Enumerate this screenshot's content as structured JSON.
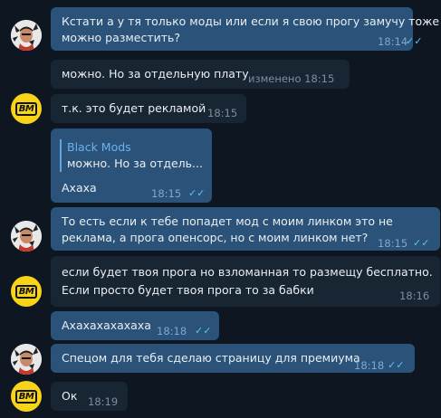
{
  "messages": [
    {
      "text_line1": "Кстати а у тя только моды или если я свою прогу замучу тоже",
      "text_line2": "можно разместить?",
      "time": "18:14"
    },
    {
      "text": "можно. Но за отдельную плату",
      "time": "изменено 18:15"
    },
    {
      "text": "т.к. это будет рекламой",
      "time": "18:15"
    },
    {
      "quote_name": "Black Mods",
      "quote_text": "можно. Но за отдель...",
      "text": "Ахаха",
      "time": "18:15"
    },
    {
      "text_line1": "То есть если к тебе попадет мод с моим линком это не",
      "text_line2": "реклама, а прога опенсорс, но с моим линком нет?",
      "time": "18:15"
    },
    {
      "text_line1": "если будет твоя прога но взломанная то размещу бесплатно.",
      "text_line2": "Если просто будет твоя прога то за бабки",
      "time": "18:16"
    },
    {
      "text": "Ахахахахахаха",
      "time": "18:18"
    },
    {
      "text": "Спецом для тебя сделаю страницу для премиума",
      "time": "18:18"
    },
    {
      "text": "Ок",
      "time": "18:19"
    }
  ],
  "avatar_bm_label": "BM",
  "icons": {
    "read": "double-check-icon"
  },
  "colors": {
    "background": "#0e1621",
    "outgoing": "#2b5278",
    "incoming": "#182533",
    "accent": "#5ec2f4"
  }
}
